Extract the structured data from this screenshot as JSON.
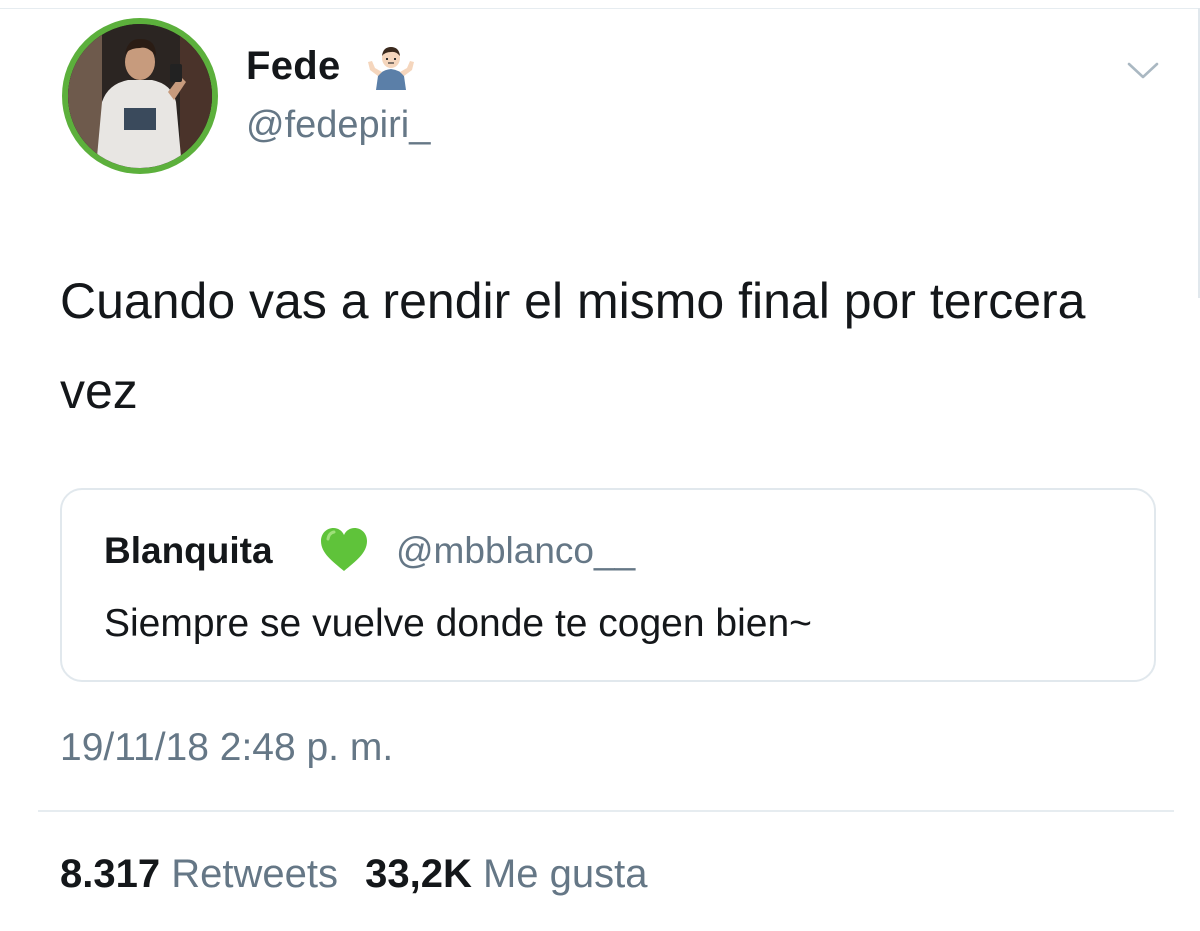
{
  "tweet": {
    "author": {
      "display_name": "Fede",
      "name_emoji": "person-shrugging-emoji",
      "handle": "@fedepiri_",
      "avatar": "profile-photo-avatar",
      "avatar_ring_color": "#5cb03c"
    },
    "text": "Cuando vas a rendir el mismo final por tercera vez",
    "quoted": {
      "display_name": "Blanquita",
      "name_emoji": "green-heart-emoji",
      "handle": "@mbblanco__",
      "text": "Siempre se vuelve donde te cogen bien~"
    },
    "timestamp": "19/11/18 2:48 p. m.",
    "stats": {
      "retweets_count": "8.317",
      "retweets_label": "Retweets",
      "likes_count": "33,2K",
      "likes_label": "Me gusta"
    },
    "menu_icon": "chevron-down-icon"
  },
  "colors": {
    "text_primary": "#14171a",
    "text_secondary": "#657786",
    "border": "#e1e8ed",
    "accent_green": "#5cb03c"
  }
}
